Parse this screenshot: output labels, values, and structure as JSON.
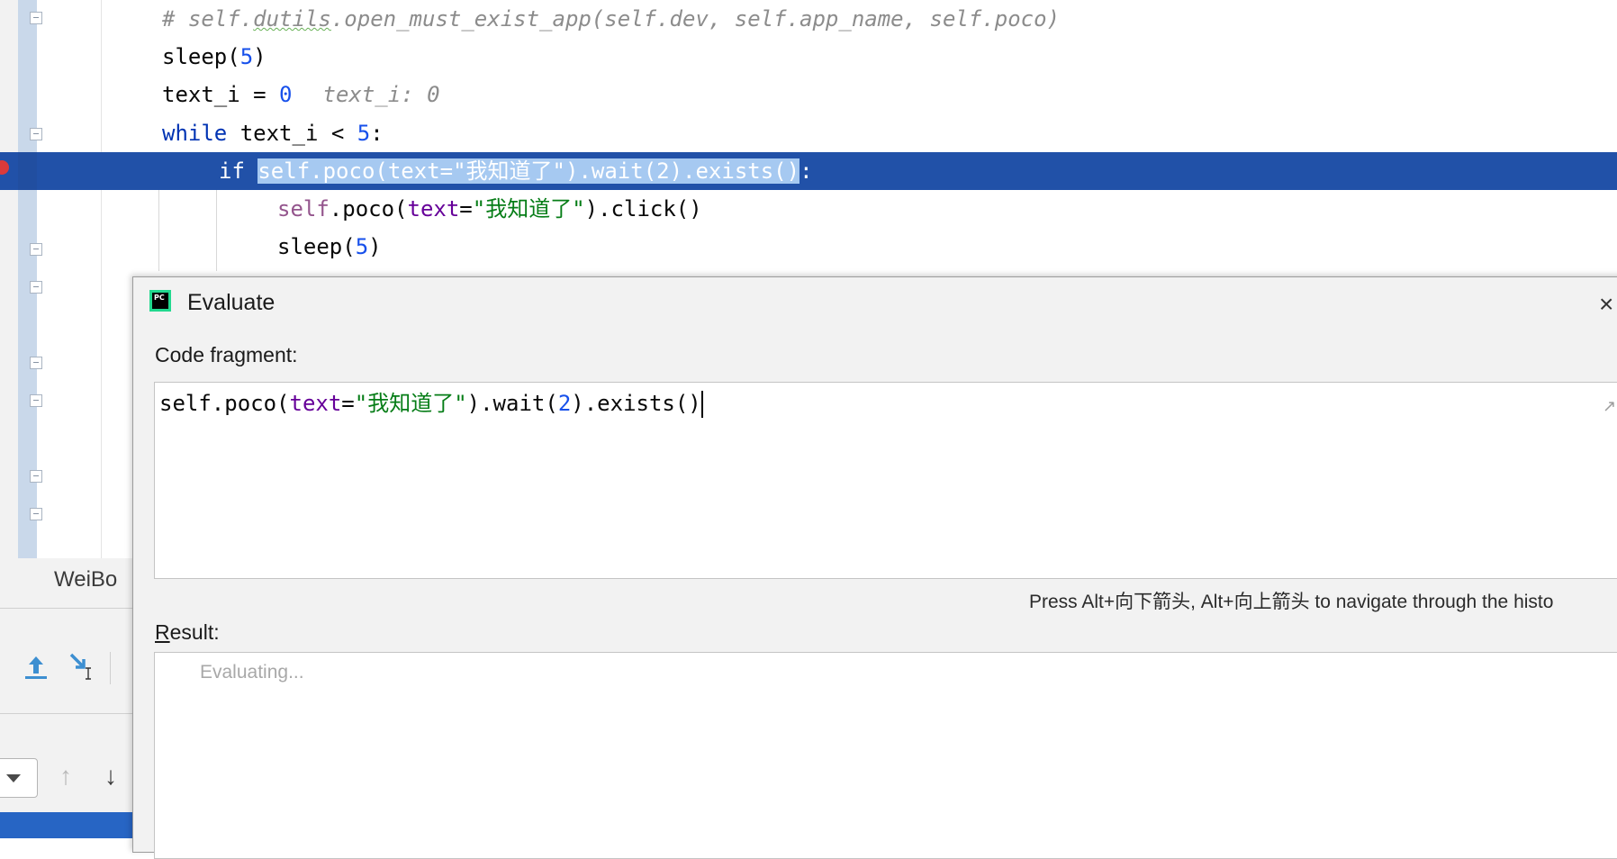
{
  "editor": {
    "lines": [
      {
        "comment": "# self.",
        "squiggle": "dutils",
        "rest": ".open_must_exist_app(self.dev, self.app_name, self.poco)"
      },
      {
        "fn": "sleep(",
        "num": "5",
        "close": ")"
      },
      {
        "var": "text_i = ",
        "num": "0",
        "hint": "text_i: 0"
      },
      {
        "kw": "while",
        "mid": " text_i < ",
        "num": "5",
        "close": ":"
      },
      {
        "kw": "if",
        "selected": "self.poco(text=\"我知道了\").wait(2).exists()",
        "close": ":"
      },
      {
        "self": "self",
        "a": ".poco(",
        "param": "text",
        "eq": "=",
        "str": "\"我知道了\"",
        "b": ").click()"
      },
      {
        "fn": "sleep(",
        "num": "5",
        "close": ")"
      }
    ]
  },
  "panel": {
    "tab_label": "WeiBo",
    "step_out_icon": "step-out-icon",
    "run_to_cursor_icon": "run-to-cursor-icon",
    "up_arrow": "↑",
    "down_arrow": "↓"
  },
  "dialog": {
    "title": "Evaluate",
    "close": "×",
    "code_label": "Code fragment:",
    "code": {
      "self": "self",
      "a": ".poco(",
      "param": "text",
      "eq": "=",
      "str": "\"我知道了\"",
      "b": ").wait(",
      "num": "2",
      "c": ").exists()"
    },
    "hint": "Press Alt+向下箭头, Alt+向上箭头 to navigate through the histo",
    "result_label_first": "R",
    "result_label_rest": "esult:",
    "result_status": "Evaluating..."
  },
  "colors": {
    "exec_line": "#2151a8",
    "selection": "#a6c9f1",
    "keyword": "#0033b3",
    "number": "#1750eb",
    "string": "#067d17",
    "breakpoint": "#db3a3a"
  }
}
